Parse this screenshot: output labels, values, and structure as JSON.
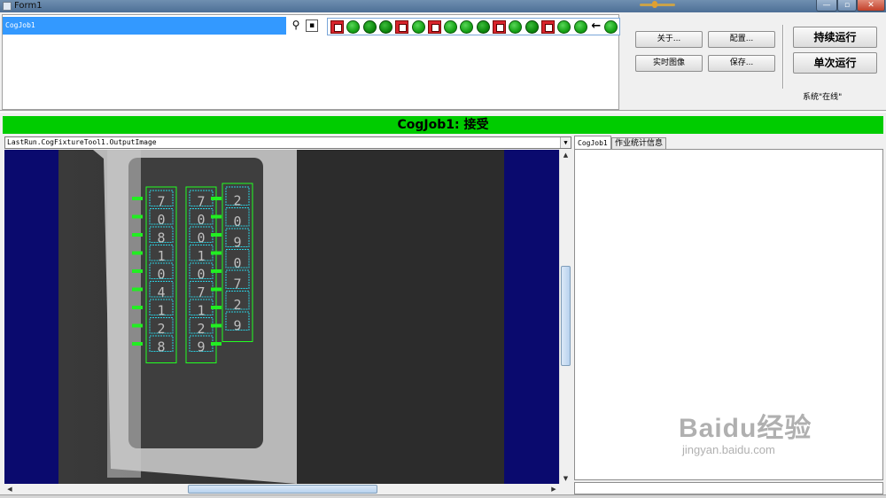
{
  "window": {
    "title": "Form1"
  },
  "job_list": {
    "job_name": "CogJob1",
    "status_icons": [
      "red",
      "green",
      "dark",
      "dark",
      "red",
      "green",
      "red",
      "green",
      "green",
      "dark",
      "red",
      "green",
      "dark",
      "red",
      "green",
      "green",
      "arrow",
      "green"
    ],
    "arrow_glyph": "←"
  },
  "buttons": {
    "about": "关于...",
    "config": "配置...",
    "live_image": "实时图像",
    "save": "保存...",
    "run_continuous": "持续运行",
    "run_once": "单次运行"
  },
  "system_status": "系统\"在线\"",
  "banner": {
    "text": "CogJob1: 接受",
    "color": "#00cc00"
  },
  "image_view": {
    "selected_image": "LastRun.CogFixtureTool1.OutputImage",
    "ocr_columns": [
      [
        "7",
        "0",
        "8",
        "1",
        "0",
        "4",
        "1",
        "2",
        "8"
      ],
      [
        "7",
        "0",
        "0",
        "1",
        "0",
        "7",
        "1",
        "2",
        "9"
      ],
      [
        "2",
        "0",
        "9",
        "0",
        "7",
        "2",
        "9"
      ]
    ]
  },
  "tabs": [
    {
      "label": "CogJob1",
      "active": true
    },
    {
      "label": "作业统计信息",
      "active": false
    }
  ],
  "watermark": {
    "main": "Baidu经验",
    "sub": "jingyan.baidu.com"
  }
}
